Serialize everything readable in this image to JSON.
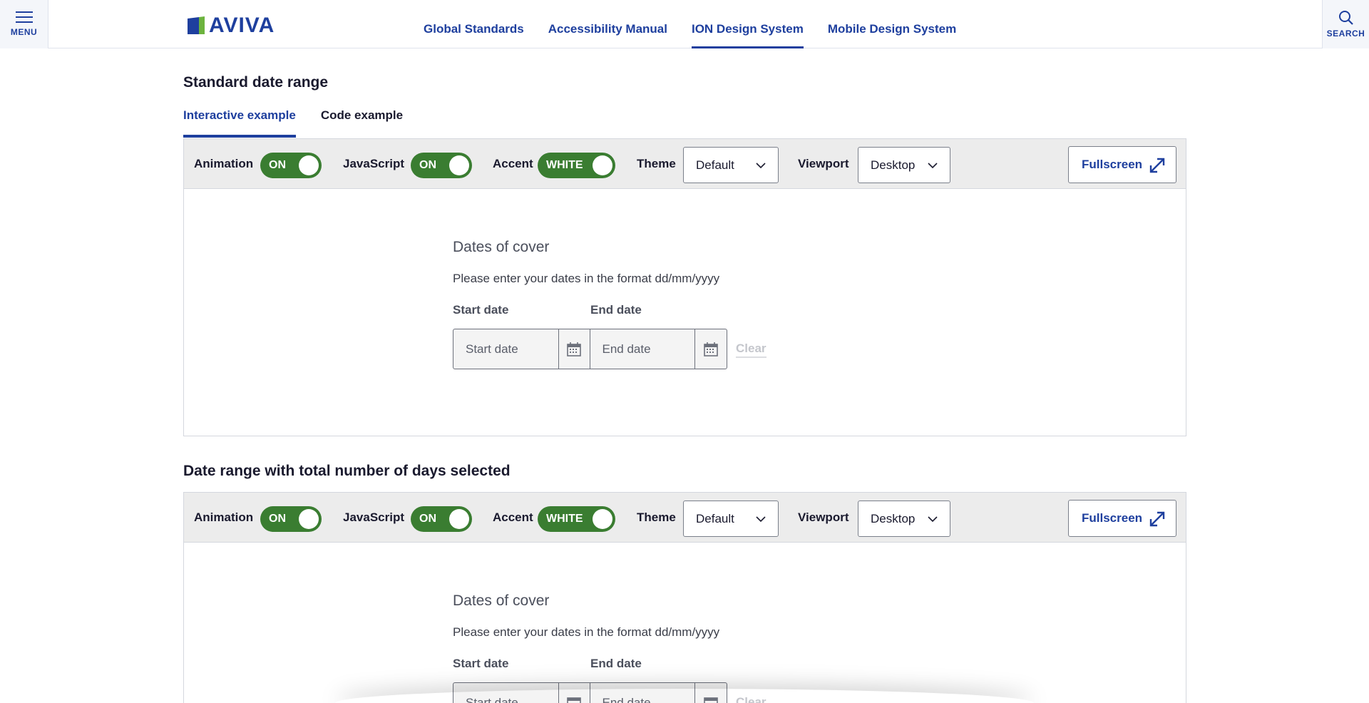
{
  "header": {
    "menu_label": "MENU",
    "search_label": "SEARCH",
    "logo_text": "AVIVA",
    "nav": [
      {
        "label": "Global Standards",
        "active": false
      },
      {
        "label": "Accessibility Manual",
        "active": false
      },
      {
        "label": "ION Design System",
        "active": true
      },
      {
        "label": "Mobile Design System",
        "active": false
      }
    ],
    "brand_color": "#1e3f9e",
    "logo_accent_color": "#6cb33e"
  },
  "sections": [
    {
      "title": "Standard date range",
      "tabs": [
        {
          "label": "Interactive example",
          "active": true
        },
        {
          "label": "Code example",
          "active": false
        }
      ],
      "toolbar": {
        "animation_label": "Animation",
        "animation_value": "ON",
        "javascript_label": "JavaScript",
        "javascript_value": "ON",
        "accent_label": "Accent",
        "accent_value": "WHITE",
        "theme_label": "Theme",
        "theme_value": "Default",
        "viewport_label": "Viewport",
        "viewport_value": "Desktop",
        "fullscreen_label": "Fullscreen"
      },
      "form": {
        "legend": "Dates of cover",
        "hint": "Please enter your dates in the format dd/mm/yyyy",
        "start_label": "Start date",
        "end_label": "End date",
        "start_placeholder": "Start date",
        "end_placeholder": "End date",
        "clear_label": "Clear"
      }
    },
    {
      "title": "Date range with total number of days selected",
      "toolbar": {
        "animation_label": "Animation",
        "animation_value": "ON",
        "javascript_label": "JavaScript",
        "javascript_value": "ON",
        "accent_label": "Accent",
        "accent_value": "WHITE",
        "theme_label": "Theme",
        "theme_value": "Default",
        "viewport_label": "Viewport",
        "viewport_value": "Desktop",
        "fullscreen_label": "Fullscreen"
      },
      "form": {
        "legend": "Dates of cover",
        "hint": "Please enter your dates in the format dd/mm/yyyy",
        "start_label": "Start date",
        "end_label": "End date",
        "start_placeholder": "Start date",
        "end_placeholder": "End date",
        "clear_label": "Clear"
      }
    }
  ],
  "icons": {
    "menu": "hamburger-icon",
    "search": "magnifier-icon",
    "fullscreen": "expand-arrows-icon",
    "calendar": "calendar-icon",
    "chevron": "chevron-down-icon"
  },
  "toggle_color": "#3a7d31"
}
